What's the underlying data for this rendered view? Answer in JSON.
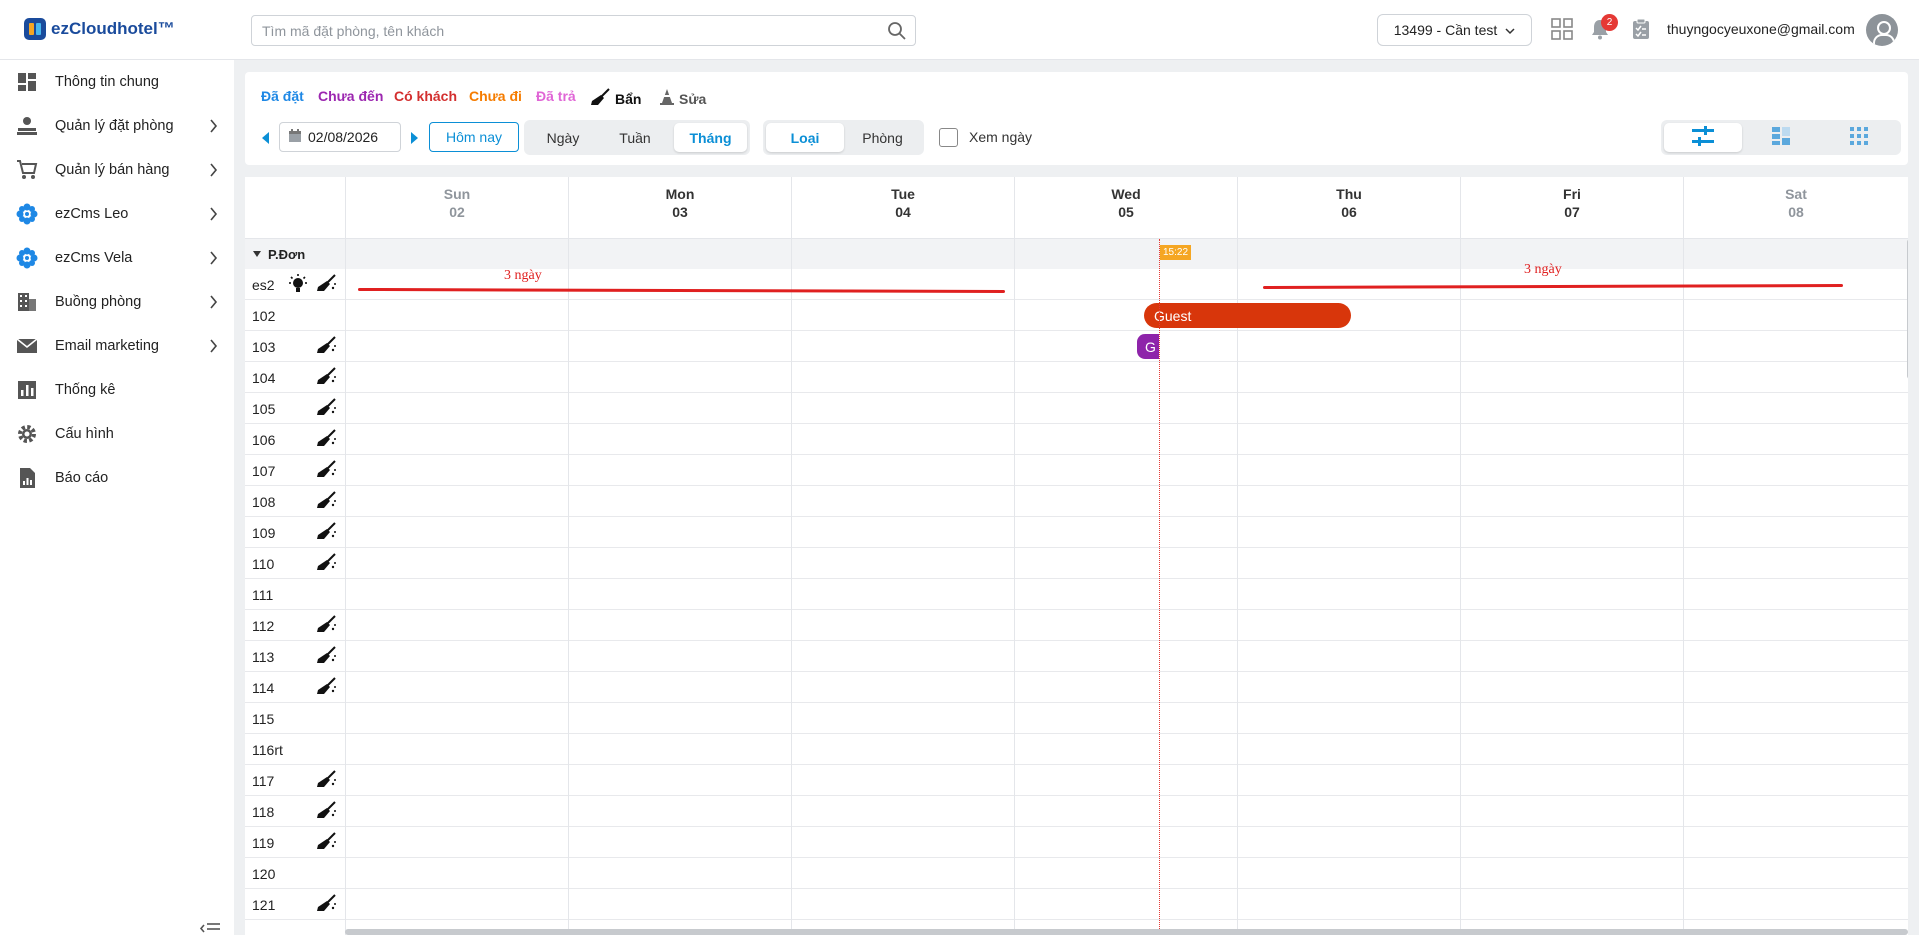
{
  "app": {
    "logo_text": "ezCloudhotel™"
  },
  "search": {
    "placeholder": "Tìm mã đặt phòng, tên khách"
  },
  "header": {
    "hotel": "13499 - Cần test",
    "notification_count": "2",
    "user_email": "thuyngocyeuxone@gmail.com"
  },
  "sidebar": {
    "items": [
      {
        "label": "Thông tin chung",
        "icon": "dashboard-icon",
        "has_children": false
      },
      {
        "label": "Quản lý đặt phòng",
        "icon": "booking-icon",
        "has_children": true
      },
      {
        "label": "Quản lý bán hàng",
        "icon": "cart-icon",
        "has_children": true
      },
      {
        "label": "ezCms Leo",
        "icon": "flower-icon",
        "has_children": true
      },
      {
        "label": "ezCms Vela",
        "icon": "flower-icon",
        "has_children": true
      },
      {
        "label": "Buồng phòng",
        "icon": "building-icon",
        "has_children": true
      },
      {
        "label": "Email marketing",
        "icon": "mail-icon",
        "has_children": true
      },
      {
        "label": "Thống kê",
        "icon": "chart-icon",
        "has_children": false
      },
      {
        "label": "Cấu hình",
        "icon": "gear-icon",
        "has_children": false
      },
      {
        "label": "Báo cáo",
        "icon": "report-icon",
        "has_children": false
      }
    ]
  },
  "legend": {
    "booked": "Đã đặt",
    "not_arrived": "Chưa đến",
    "has_guest": "Có khách",
    "not_left": "Chưa đi",
    "checked_out": "Đã trả",
    "dirty": "Bẩn",
    "repair": "Sửa"
  },
  "colors": {
    "booked": "#1e88e5",
    "not_arrived": "#9c27b0",
    "has_guest": "#d32f2f",
    "not_left": "#f57c00",
    "checked_out": "#e066d6",
    "accent": "#0b8fd6",
    "booking_red": "#d8360b",
    "booking_purple": "#8e24aa",
    "annotation": "#e02020"
  },
  "toolbar": {
    "date": "02/08/2026",
    "today": "Hôm nay",
    "range_tabs": [
      "Ngày",
      "Tuần",
      "Tháng"
    ],
    "range_active": "Tháng",
    "group_tabs": [
      "Loại",
      "Phòng"
    ],
    "group_active": "Loại",
    "view_day_label": "Xem ngày"
  },
  "calendar": {
    "days": [
      {
        "name": "Sun",
        "date": "02",
        "weekend": true
      },
      {
        "name": "Mon",
        "date": "03",
        "weekend": false
      },
      {
        "name": "Tue",
        "date": "04",
        "weekend": false
      },
      {
        "name": "Wed",
        "date": "05",
        "weekend": false
      },
      {
        "name": "Thu",
        "date": "06",
        "weekend": false
      },
      {
        "name": "Fri",
        "date": "07",
        "weekend": false
      },
      {
        "name": "Sat",
        "date": "08",
        "weekend": true
      }
    ],
    "group": "P.Đơn",
    "now_time": "15:22",
    "rooms": [
      {
        "name": "es2",
        "status": [
          "light",
          "dirty"
        ]
      },
      {
        "name": "102",
        "status": []
      },
      {
        "name": "103",
        "status": [
          "dirty"
        ]
      },
      {
        "name": "104",
        "status": [
          "dirty"
        ]
      },
      {
        "name": "105",
        "status": [
          "dirty"
        ]
      },
      {
        "name": "106",
        "status": [
          "dirty"
        ]
      },
      {
        "name": "107",
        "status": [
          "dirty"
        ]
      },
      {
        "name": "108",
        "status": [
          "dirty"
        ]
      },
      {
        "name": "109",
        "status": [
          "dirty"
        ]
      },
      {
        "name": "110",
        "status": [
          "dirty"
        ]
      },
      {
        "name": "111",
        "status": []
      },
      {
        "name": "112",
        "status": [
          "dirty"
        ]
      },
      {
        "name": "113",
        "status": [
          "dirty"
        ]
      },
      {
        "name": "114",
        "status": [
          "dirty"
        ]
      },
      {
        "name": "115",
        "status": []
      },
      {
        "name": "116rt",
        "status": []
      },
      {
        "name": "117",
        "status": [
          "dirty"
        ]
      },
      {
        "name": "118",
        "status": [
          "dirty"
        ]
      },
      {
        "name": "119",
        "status": [
          "dirty"
        ]
      },
      {
        "name": "120",
        "status": []
      },
      {
        "name": "121",
        "status": [
          "dirty"
        ]
      }
    ],
    "bookings": [
      {
        "room": "102",
        "label": "Guest",
        "color": "#d8360b"
      },
      {
        "room": "103",
        "label": "G",
        "color": "#8e24aa"
      }
    ],
    "annotations": [
      "3 ngày",
      "3 ngày"
    ]
  }
}
